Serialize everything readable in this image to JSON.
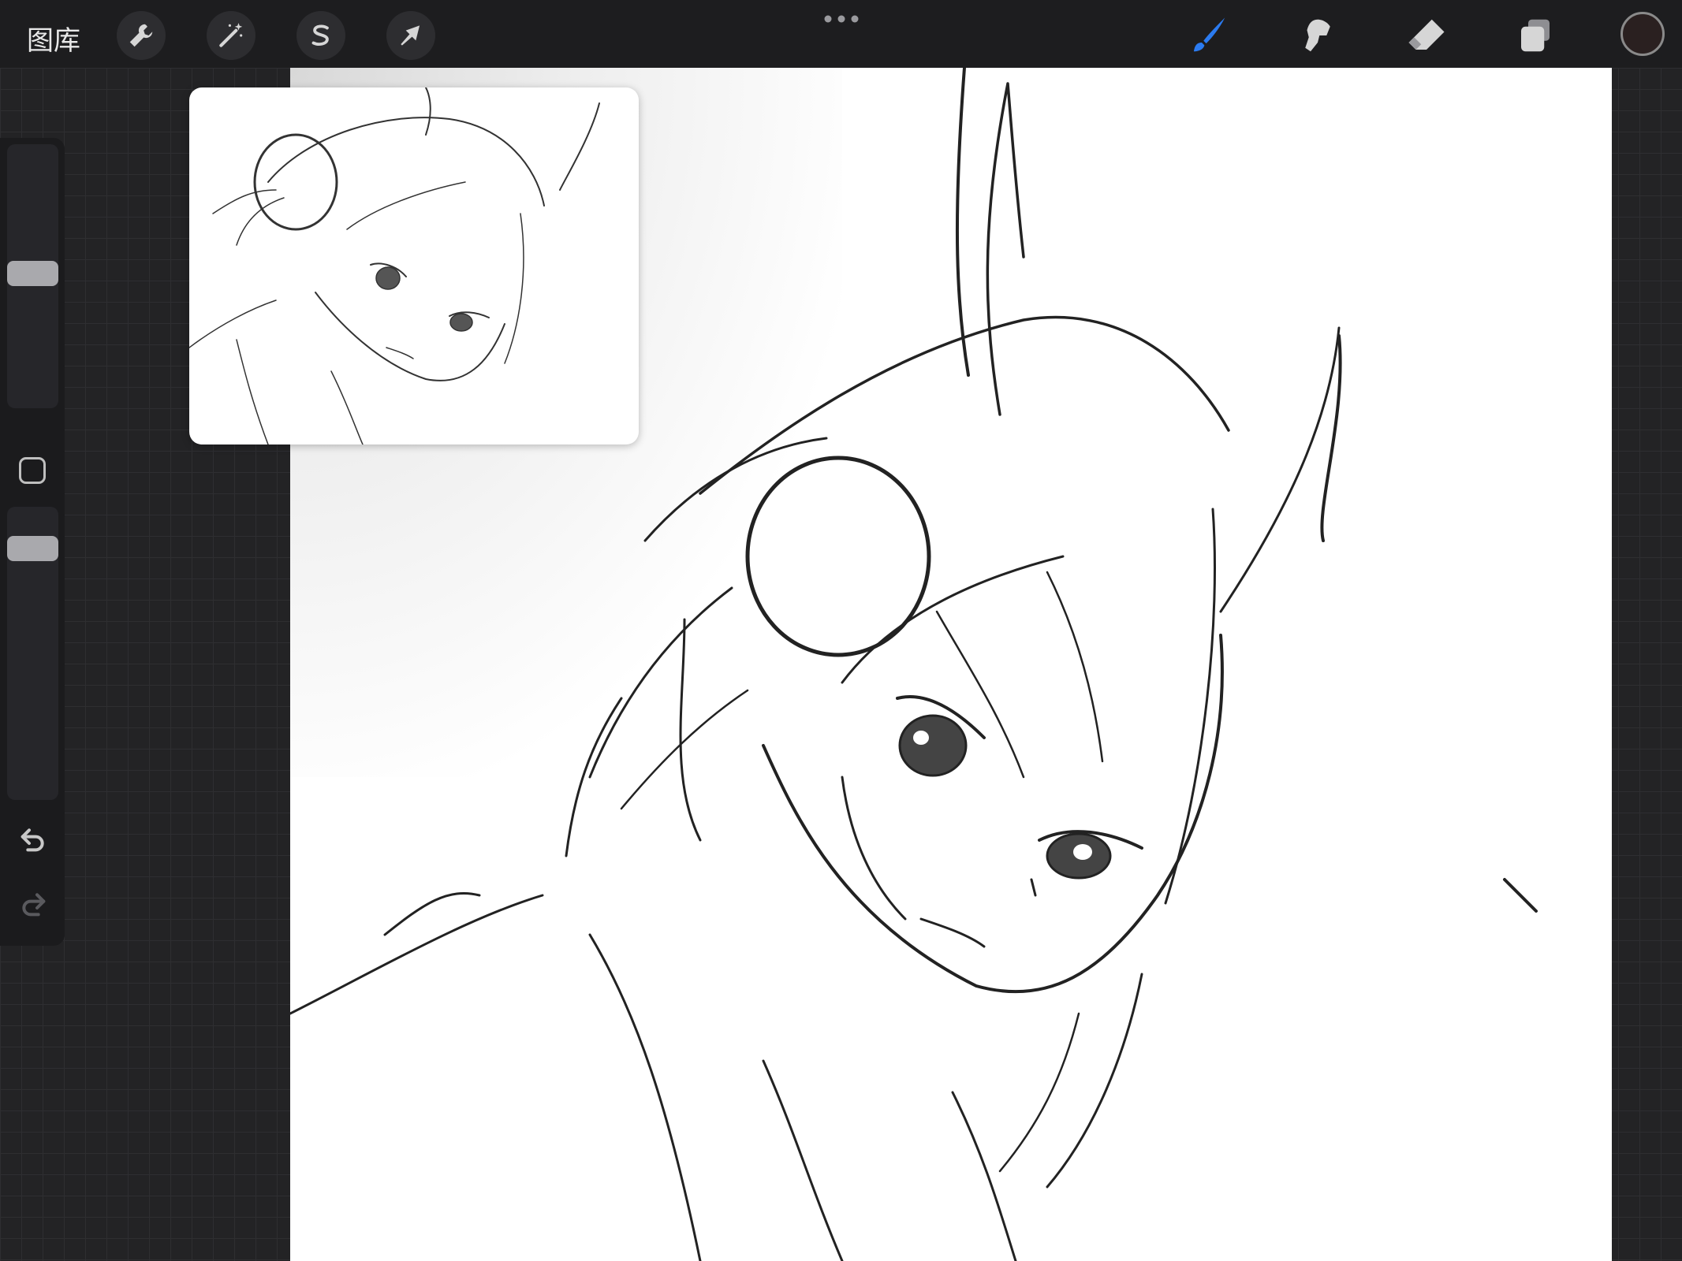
{
  "topbar": {
    "gallery_label": "图库",
    "left_tools": [
      {
        "name": "actions",
        "icon": "wrench-icon"
      },
      {
        "name": "adjustments",
        "icon": "magic-wand-icon"
      },
      {
        "name": "selection",
        "icon": "selection-s-icon"
      },
      {
        "name": "transform",
        "icon": "arrow-cursor-icon"
      }
    ],
    "more_icon": "more-dots-icon",
    "right_tools": [
      {
        "name": "brush",
        "icon": "brush-icon",
        "active": true,
        "color": "#2b7bf0"
      },
      {
        "name": "smudge",
        "icon": "smudge-icon"
      },
      {
        "name": "eraser",
        "icon": "eraser-icon"
      },
      {
        "name": "layers",
        "icon": "layers-icon"
      }
    ],
    "current_color": "#2a2020"
  },
  "sidebar": {
    "brush_size_icon": "brush-size-slider",
    "modify_icon": "square-modify-icon",
    "opacity_icon": "opacity-slider",
    "undo_icon": "undo-icon",
    "redo_icon": "redo-icon"
  },
  "canvas": {
    "content": "pencil-sketch",
    "background": "#ffffff"
  },
  "reference_window": {
    "content": "sketch-reference-thumbnail"
  },
  "colors": {
    "toolbar_bg": "#1d1d1f",
    "workspace_bg": "#232325",
    "accent_blue": "#2b7bf0",
    "icon_gray": "#d6d6d6"
  }
}
